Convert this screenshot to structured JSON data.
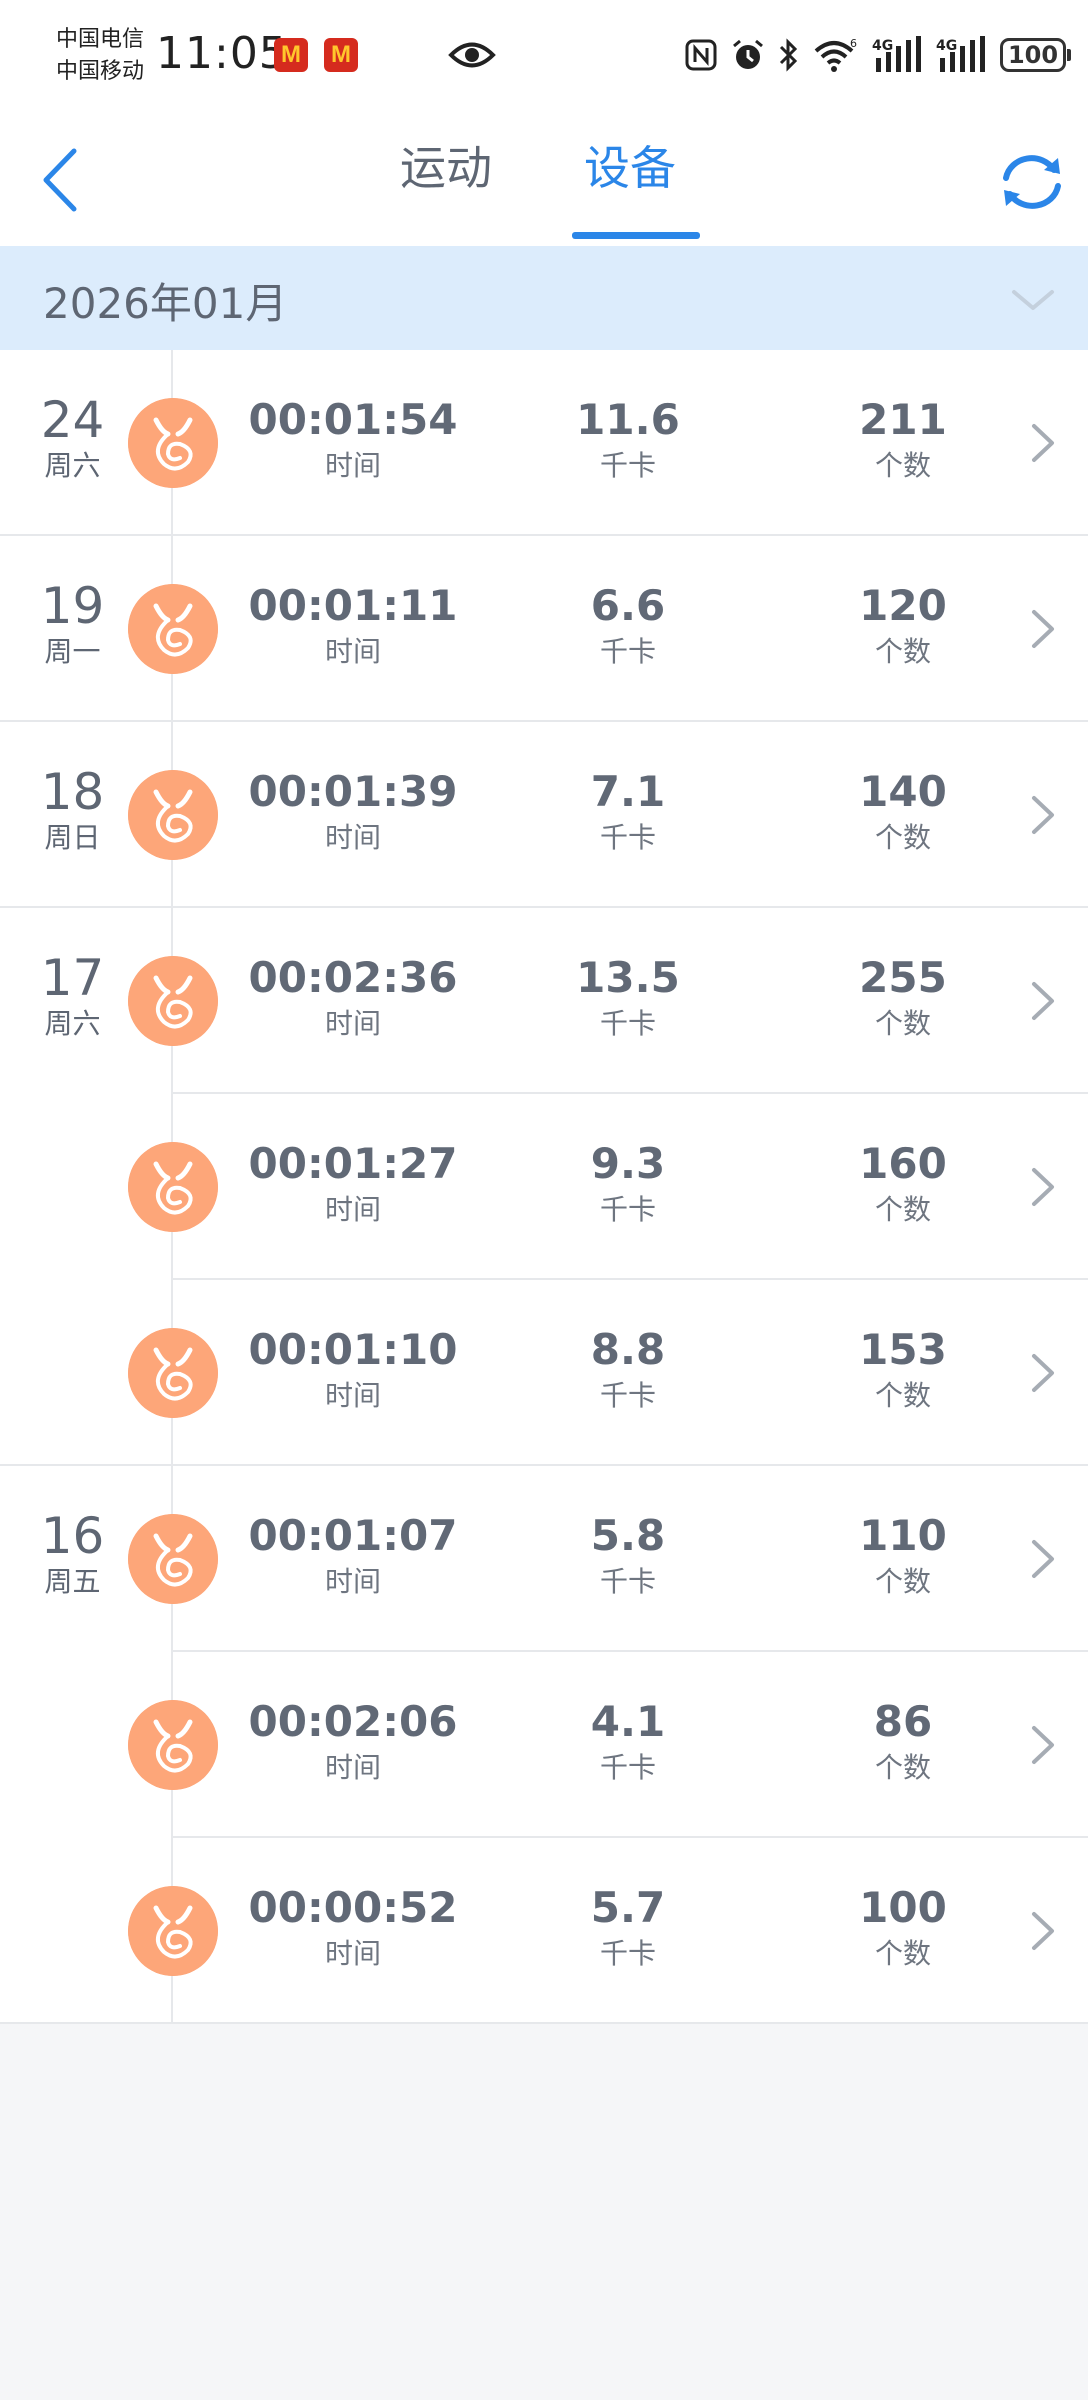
{
  "status_bar": {
    "carrier_1": "中国电信",
    "carrier_2": "中国移动",
    "time": "11:05",
    "notification_icons": [
      "mcdonalds-icon",
      "mcdonalds-icon"
    ],
    "right_icons": [
      "eye-icon",
      "nfc-icon",
      "alarm-icon",
      "bluetooth-icon",
      "wifi-icon",
      "signal-4g-icon",
      "signal-4g-icon"
    ],
    "battery": "100"
  },
  "header": {
    "tabs": [
      {
        "label": "运动",
        "active": false
      },
      {
        "label": "设备",
        "active": true
      }
    ],
    "accent_color": "#2b86e8"
  },
  "month_bar": {
    "label": "2026年01月"
  },
  "records": [
    {
      "day": "24",
      "weekday": "周六",
      "time": "00:01:54",
      "kcal": "11.6",
      "count": "211"
    },
    {
      "day": "19",
      "weekday": "周一",
      "time": "00:01:11",
      "kcal": "6.6",
      "count": "120"
    },
    {
      "day": "18",
      "weekday": "周日",
      "time": "00:01:39",
      "kcal": "7.1",
      "count": "140"
    },
    {
      "day": "17",
      "weekday": "周六",
      "time": "00:02:36",
      "kcal": "13.5",
      "count": "255"
    },
    {
      "day": "",
      "weekday": "",
      "time": "00:01:27",
      "kcal": "9.3",
      "count": "160"
    },
    {
      "day": "",
      "weekday": "",
      "time": "00:01:10",
      "kcal": "8.8",
      "count": "153"
    },
    {
      "day": "16",
      "weekday": "周五",
      "time": "00:01:07",
      "kcal": "5.8",
      "count": "110"
    },
    {
      "day": "",
      "weekday": "",
      "time": "00:02:06",
      "kcal": "4.1",
      "count": "86"
    },
    {
      "day": "",
      "weekday": "",
      "time": "00:00:52",
      "kcal": "5.7",
      "count": "100"
    }
  ],
  "labels": {
    "time": "时间",
    "kcal": "千卡",
    "count": "个数"
  },
  "icon_color": "#fda679"
}
